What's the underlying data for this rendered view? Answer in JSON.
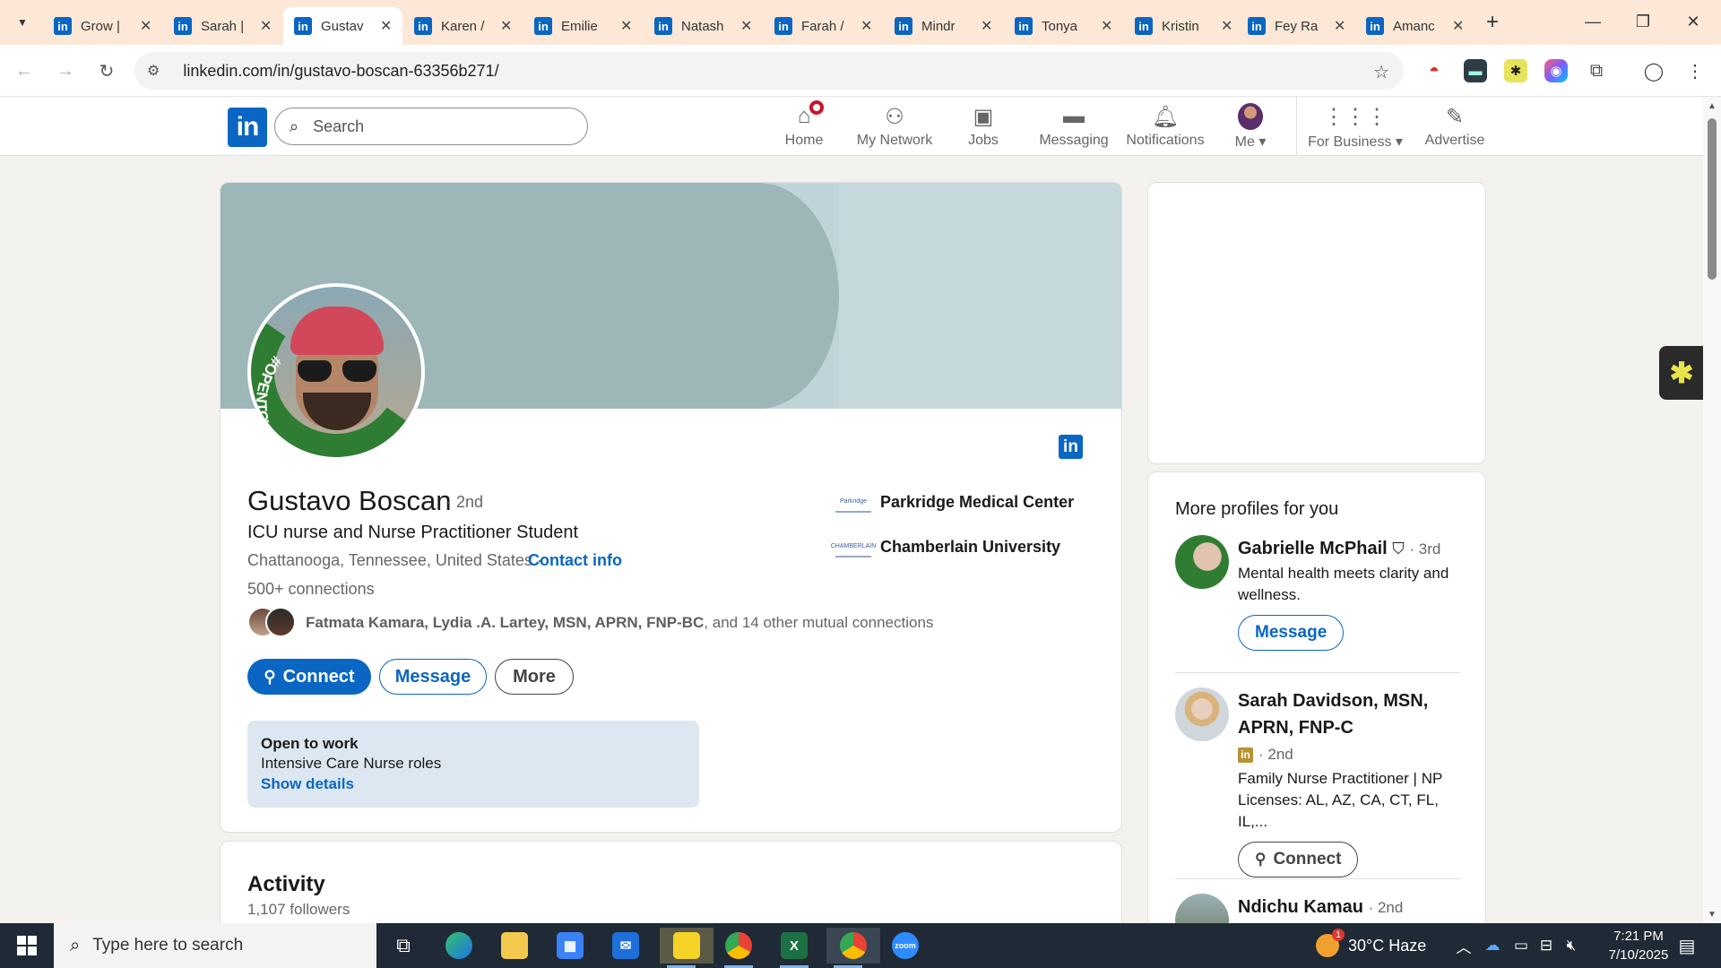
{
  "browser": {
    "tabs": [
      {
        "title": "Grow |"
      },
      {
        "title": "Sarah |"
      },
      {
        "title": "Gustav"
      },
      {
        "title": "Karen /"
      },
      {
        "title": "Emilie"
      },
      {
        "title": "Natash"
      },
      {
        "title": "Farah /"
      },
      {
        "title": "Mindr"
      },
      {
        "title": "Tonya"
      },
      {
        "title": "Kristin"
      },
      {
        "title": "Fey Ra"
      },
      {
        "title": "Amanc"
      }
    ],
    "active_tab_index": 2,
    "url": "linkedin.com/in/gustavo-boscan-63356b271/"
  },
  "header": {
    "logo": "in",
    "search_placeholder": "Search",
    "nav": [
      {
        "label": "Home",
        "icon": "home-icon"
      },
      {
        "label": "My Network",
        "icon": "network-icon"
      },
      {
        "label": "Jobs",
        "icon": "briefcase-icon"
      },
      {
        "label": "Messaging",
        "icon": "chat-icon"
      },
      {
        "label": "Notifications",
        "icon": "bell-icon"
      },
      {
        "label": "Me",
        "icon": "avatar"
      },
      {
        "label": "For Business",
        "icon": "grid-icon"
      },
      {
        "label": "Advertise",
        "icon": "compass-icon"
      }
    ]
  },
  "profile": {
    "avatar_frame_text": "#OPENTOWORK",
    "name": "Gustavo Boscan",
    "degree": "· 2nd",
    "headline": "ICU nurse and Nurse Practitioner Student",
    "location": "Chattanooga, Tennessee, United States ·",
    "contact_info": "Contact info",
    "connections": "500+ connections",
    "mutual_names": "Fatmata Kamara, Lydia .A. Lartey, MSN, APRN, FNP-BC",
    "mutual_rest": ", and 14 other mutual connections",
    "experience": [
      {
        "name": "Parkridge Medical Center",
        "logo_text": "Parkridge"
      },
      {
        "name": "Chamberlain University",
        "logo_text": "CHAMBERLAIN"
      }
    ],
    "buttons": {
      "connect": "Connect",
      "message": "Message",
      "more": "More"
    },
    "open_to_work": {
      "title": "Open to work",
      "roles": "Intensive Care Nurse roles",
      "link": "Show details"
    }
  },
  "activity": {
    "title": "Activity",
    "followers": "1,107 followers"
  },
  "more_profiles": {
    "title": "More profiles for you",
    "items": [
      {
        "name": "Gabrielle McPhail",
        "degree": "· 3rd",
        "description": "Mental health meets clarity and wellness.",
        "button": "Message"
      },
      {
        "name": "Sarah Davidson, MSN, APRN, FNP-C",
        "degree": "· 2nd",
        "description": "Family Nurse Practitioner | NP Licenses: AL, AZ, CA, CT, FL, IL,...",
        "button": "Connect"
      },
      {
        "name": "Ndichu Kamau",
        "degree": "· 2nd"
      }
    ]
  },
  "taskbar": {
    "search_placeholder": "Type here to search",
    "weather": "30°C  Haze",
    "time": "7:21 PM",
    "date": "7/10/2025"
  }
}
